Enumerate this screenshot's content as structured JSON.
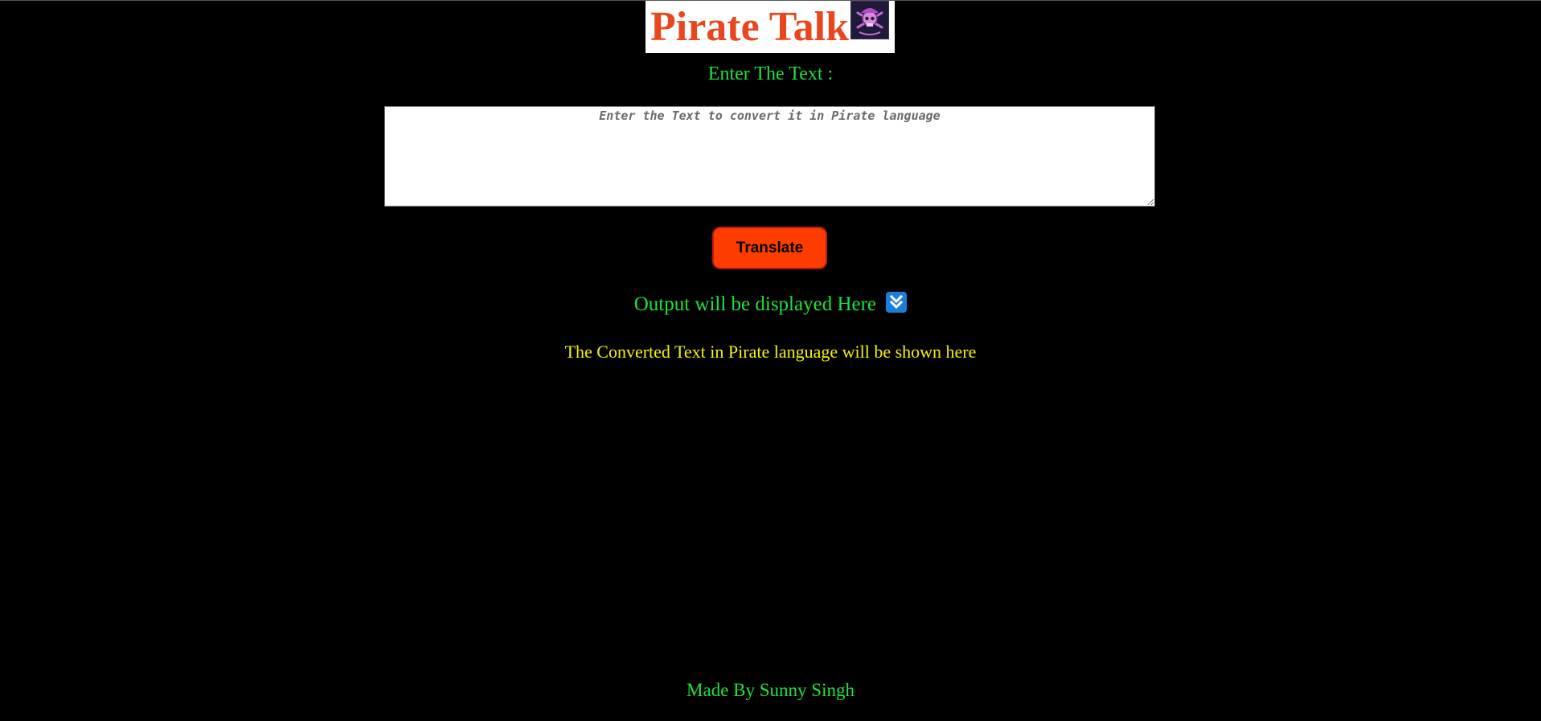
{
  "header": {
    "title": "Pirate Talk",
    "logo_icon": "pirate-skull-logo-icon"
  },
  "input": {
    "heading": "Enter The Text :",
    "placeholder": "Enter the Text to convert it in Pirate language",
    "value": ""
  },
  "actions": {
    "translate_label": "Translate"
  },
  "output": {
    "heading": "Output will be displayed Here",
    "heading_icon": "double-down-arrow-icon",
    "text": "The Converted Text in Pirate language will be shown here"
  },
  "footer": {
    "credit": "Made By Sunny Singh"
  },
  "colors": {
    "background": "#000000",
    "title": "#e8471d",
    "green_text": "#1fe23c",
    "output_text": "#f5f20a",
    "button": "#ff3c00",
    "button_border": "#c01818",
    "arrow_badge": "#1a7fd9"
  }
}
